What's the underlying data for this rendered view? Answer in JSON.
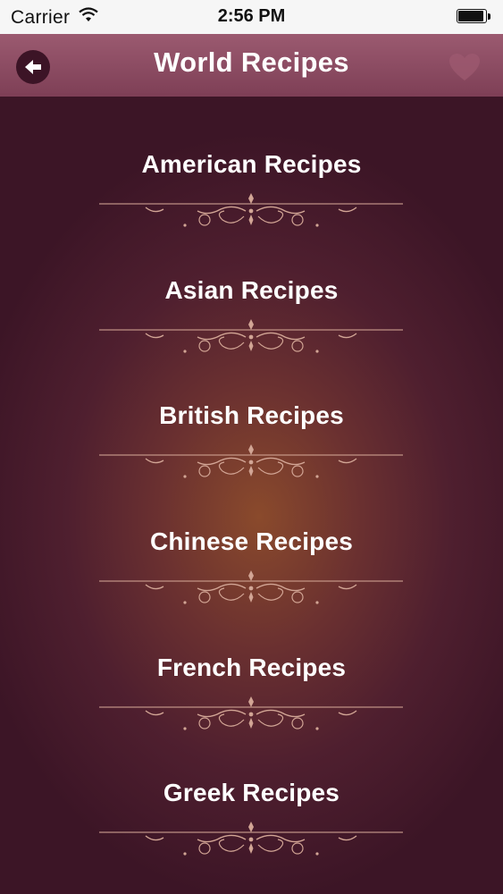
{
  "status_bar": {
    "carrier": "Carrier",
    "time": "2:56 PM",
    "wifi_icon": "wifi-icon",
    "battery_icon": "battery-icon"
  },
  "nav": {
    "title": "World Recipes",
    "back_icon": "back-arrow-icon",
    "favorite_icon": "heart-icon"
  },
  "recipes": [
    {
      "label": "American Recipes"
    },
    {
      "label": "Asian Recipes"
    },
    {
      "label": "British Recipes"
    },
    {
      "label": "Chinese Recipes"
    },
    {
      "label": "French Recipes"
    },
    {
      "label": "Greek Recipes"
    }
  ],
  "colors": {
    "nav_bar": "#8a4a60",
    "background": "#3c1526",
    "ornament": "#d2a595",
    "text": "#ffffff"
  }
}
